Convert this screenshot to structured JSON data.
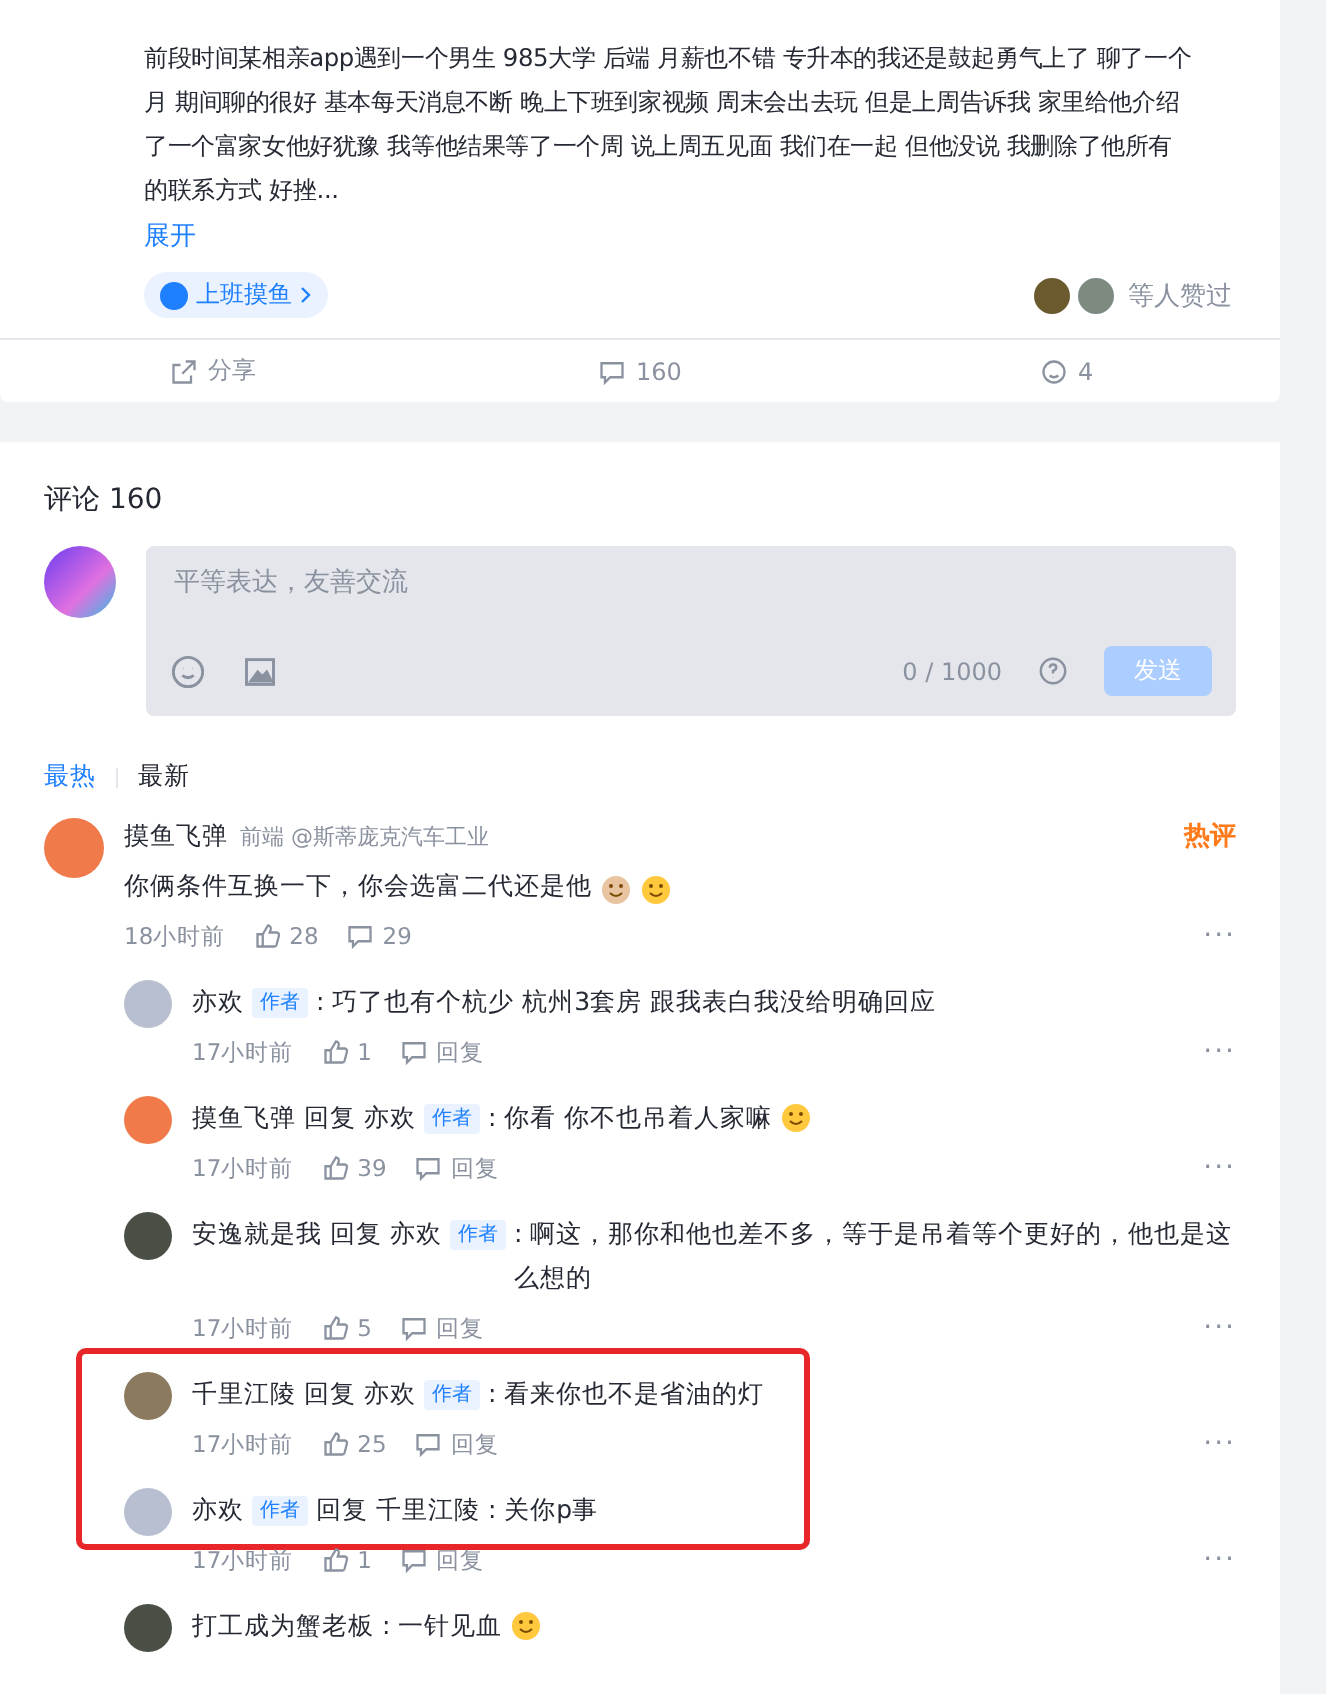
{
  "post": {
    "lines": [
      "前段时间某相亲app遇到一个男生 985大学 后端 月薪也不错 专升本的我还是鼓起勇气上了 聊了一个",
      "月 期间聊的很好 基本每天消息不断 晚上下班到家视频 周末会出去玩 但是上周告诉我 家里给他介绍",
      "了一个富家女他好犹豫 我等他结果等了一个周 说上周五见面 我们在一起 但他没说 我删除了他所有",
      "的联系方式 好挫..."
    ],
    "expand": "展开",
    "tag": "上班摸鱼",
    "likers": "等人赞过",
    "actions": [
      {
        "kind": "share",
        "label": "分享"
      },
      {
        "kind": "comment",
        "label": "160"
      },
      {
        "kind": "like",
        "label": "4"
      }
    ]
  },
  "comments": {
    "title": "评论 160",
    "input": {
      "placeholder": "平等表达，友善交流",
      "counter": "0 / 1000",
      "send": "发送"
    },
    "sort_tabs": [
      {
        "label": "最热",
        "selected": true
      },
      {
        "label": "最新",
        "selected": false
      }
    ],
    "items": [
      {
        "author": "摸鱼飞弹",
        "job": "前端 @斯蒂庞克汽车工业",
        "badge": "热评",
        "text": "你俩条件互换一下，你会选富二代还是他",
        "emoji": true,
        "time": "18小时前",
        "likes": "28",
        "replies_count": "29",
        "more": "···",
        "replies": [
          {
            "author": "亦欢",
            "author_tag": "作者",
            "text": ": 巧了也有个杭少 杭州3套房 跟我表白我没给明确回应",
            "time": "17小时前",
            "likes": "1",
            "reply": "回复",
            "more": "···",
            "highlighted": false,
            "emoji": false
          },
          {
            "author": "摸鱼飞弹",
            "reply_word": "回复",
            "target": "亦欢",
            "target_tag": "作者",
            "text": ": 你看 你不也吊着人家嘛",
            "time": "17小时前",
            "likes": "39",
            "reply": "回复",
            "more": "···",
            "highlighted": false,
            "emoji": true
          },
          {
            "author": "安逸就是我",
            "reply_word": "回复",
            "target": "亦欢",
            "target_tag": "作者",
            "text": ": 啊这，那你和他也差不多，等于是吊着等个更好的，他也是这么想的",
            "time": "17小时前",
            "likes": "5",
            "reply": "回复",
            "more": "···",
            "highlighted": false,
            "emoji": false
          },
          {
            "author": "千里江陵",
            "reply_word": "回复",
            "target": "亦欢",
            "target_tag": "作者",
            "text": ": 看来你也不是省油的灯",
            "time": "17小时前",
            "likes": "25",
            "reply": "回复",
            "more": "···",
            "highlighted": true,
            "emoji": false
          },
          {
            "author": "亦欢",
            "author_tag": "作者",
            "reply_word": "回复",
            "target": "千里江陵",
            "text": ": 关你p事",
            "time": "17小时前",
            "likes": "1",
            "reply": "回复",
            "more": "···",
            "highlighted": true,
            "emoji": false
          },
          {
            "author": "打工成为蟹老板",
            "text": ": 一针见血",
            "highlighted": false,
            "emoji": true
          }
        ]
      }
    ]
  }
}
